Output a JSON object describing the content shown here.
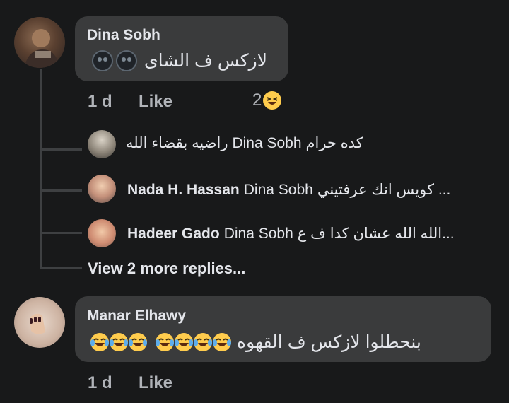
{
  "comment1": {
    "author": "Dina Sobh",
    "text": "لازكس ف الشاى",
    "emojis": [
      "new-moon-face",
      "new-moon-face"
    ],
    "time": "1 d",
    "like_label": "Like",
    "reaction_count": "2",
    "reaction_icon": "laughing-squinting-face",
    "replies": [
      {
        "author": "",
        "tag": "Dina Sobh",
        "text_before": "راضيه بقضاء الله",
        "text_after": "كده حرام"
      },
      {
        "author": "Nada H. Hassan",
        "tag": "Dina Sobh",
        "text": "... كويس انك عرفتيني"
      },
      {
        "author": "Hadeer Gado",
        "tag": "Dina Sobh",
        "text": "...الله الله عشان كدا ف ع"
      }
    ],
    "view_more": "View 2 more replies..."
  },
  "comment2": {
    "author": "Manar Elhawy",
    "text": "بنحطلوا لازكس ف القهوه",
    "emojis": [
      "tears-of-joy-face",
      "tears-of-joy-face",
      "tears-of-joy-face",
      "tears-of-joy-face",
      "tears-of-joy-face",
      "tears-of-joy-face",
      "tears-of-joy-face"
    ],
    "time": "1 d",
    "like_label": "Like"
  },
  "colors": {
    "background": "#18191a",
    "bubble": "#3a3b3c",
    "text": "#e4e6eb",
    "meta": "#b0b3b8",
    "emoji_yellow": "#ffcc4d"
  }
}
